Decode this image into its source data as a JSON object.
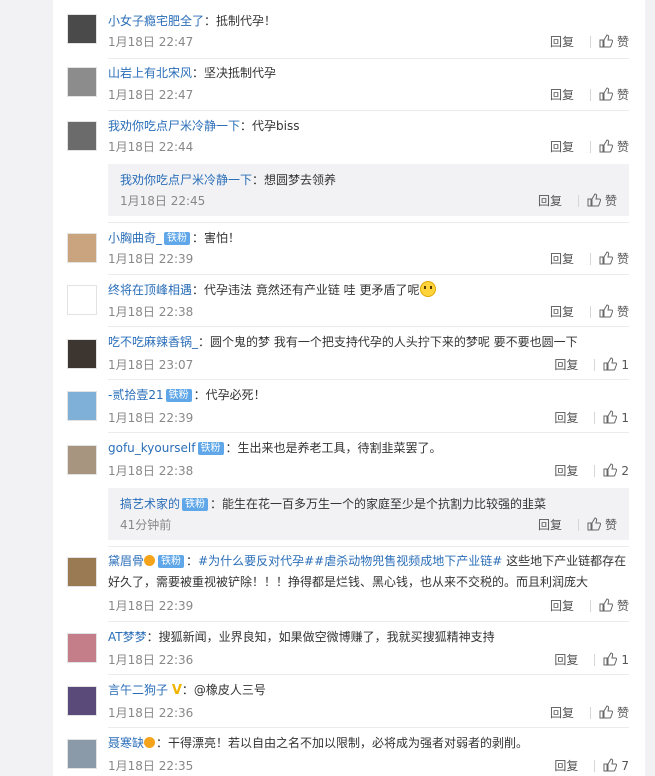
{
  "labels": {
    "reply": "回复",
    "like": "赞"
  },
  "comments": [
    {
      "user": "小女子瘾宅肥全了",
      "text": "：抵制代孕！",
      "time": "1月18日 22:47",
      "likes": "赞",
      "avatar": "#4a4a4a"
    },
    {
      "user": "山岩上有北宋风",
      "text": "：坚决抵制代孕",
      "time": "1月18日 22:47",
      "likes": "赞",
      "avatar": "#8c8c8c"
    },
    {
      "user": "我劝你吃点尸米冷静一下",
      "text": "：代孕biss",
      "time": "1月18日 22:44",
      "likes": "赞",
      "avatar": "#6b6b6b"
    },
    {
      "user": "小胸曲奇_",
      "tag": "铁粉",
      "text": "：害怕！",
      "time": "1月18日 22:39",
      "likes": "赞",
      "avatar": "#c9a47e"
    },
    {
      "user": "终将在顶峰相遇",
      "text": "：代孕违法 竟然还有产业链 哇 更矛盾了呢",
      "time": "1月18日 22:38",
      "likes": "赞",
      "avatar": "#ffffff"
    },
    {
      "user": "吃不吃麻辣香锅_",
      "text": "：圆个鬼的梦 我有一个把支持代孕的人头拧下来的梦呢 要不要也圆一下",
      "time": "1月18日 23:07",
      "likes": "1",
      "avatar": "#3d3530"
    },
    {
      "user": "-贰拾壹21",
      "tag": "铁粉",
      "text": "：代孕必死！",
      "time": "1月18日 22:39",
      "likes": "1",
      "avatar": "#7fb0d8"
    },
    {
      "user": "gofu_kyourself",
      "tag": "铁粉",
      "text": "：生出来也是养老工具，待割韭菜罢了。",
      "time": "1月18日 22:38",
      "likes": "2",
      "avatar": "#a89580"
    },
    {
      "user": "黛眉骨",
      "text": " 这些地下产业链都存在好久了，需要被重视被铲除！！！挣得都是烂钱、黑心钱，也从来不交税的。而且利润庞大",
      "hashtag1": "#为什么要反对代孕#",
      "hashtag2": "#虐杀动物兜售视频成地下产业链#",
      "time": "1月18日 22:39",
      "likes": "赞",
      "avatar": "#9a7a52",
      "tag": "铁粉"
    },
    {
      "user": "AT梦梦",
      "text": "：搜狐新闻，业界良知，如果做空微博赚了，我就买搜狐精神支持",
      "time": "1月18日 22:36",
      "likes": "1",
      "avatar": "#c47e8a"
    },
    {
      "user": "言午二狗子",
      "text": "：@橡皮人三号",
      "time": "1月18日 22:36",
      "likes": "赞",
      "avatar": "#5a4a7a"
    },
    {
      "user": "聂寒缺",
      "text": "：干得漂亮！若以自由之名不加以限制，必将成为强者对弱者的剥削。",
      "time": "1月18日 22:35",
      "likes": "7",
      "avatar": "#8a9aa8"
    }
  ],
  "replies": [
    {
      "user": "我劝你吃点尸米冷静一下",
      "text": "：想圆梦去领养",
      "time": "1月18日 22:45",
      "likes": "赞"
    },
    {
      "user": "搞艺术家的",
      "tag": "铁粉",
      "text": "：能生在花一百多万生一个的家庭至少是个抗割力比较强的韭菜",
      "time": "41分钟前",
      "likes": "赞"
    }
  ]
}
